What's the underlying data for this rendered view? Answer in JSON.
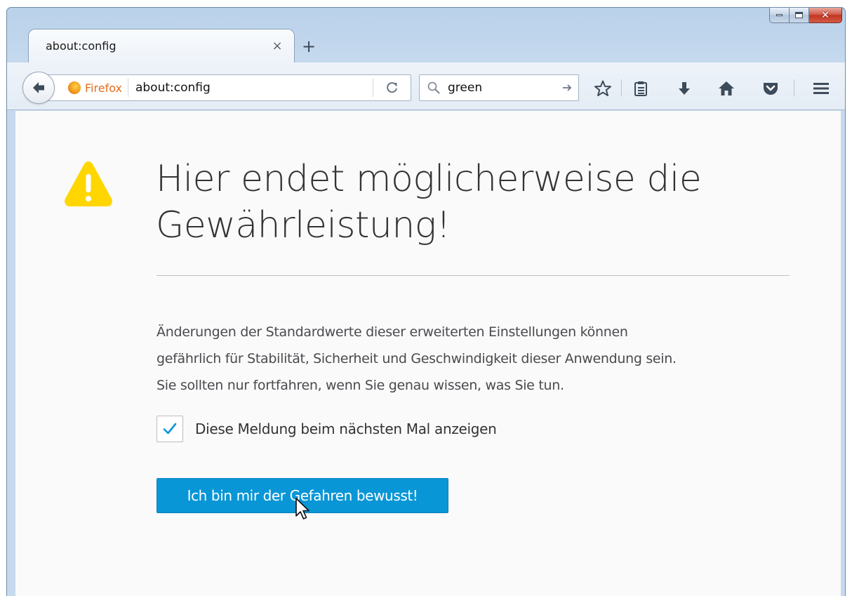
{
  "window": {
    "caption_buttons": {
      "minimize": "minimize",
      "maximize": "maximize",
      "close": "✕"
    }
  },
  "tabs": [
    {
      "title": "about:config",
      "close": "×"
    }
  ],
  "new_tab_label": "+",
  "navbar": {
    "identity_label": "Firefox",
    "url": "about:config",
    "search_value": "green"
  },
  "icons": {
    "back": "back-arrow-icon",
    "reload": "reload-icon",
    "search": "magnifier-icon",
    "search_go": "arrow-right-icon",
    "bookmark": "star-icon",
    "bookmarks_menu": "clipboard-list-icon",
    "downloads": "download-arrow-icon",
    "home": "home-icon",
    "pocket": "pocket-icon",
    "menu": "hamburger-icon",
    "warning": "warning-triangle-icon"
  },
  "page": {
    "title": "Hier endet möglicherweise die Gewährleistung!",
    "message_lines": [
      "Änderungen der Standardwerte dieser erweiterten Einstellungen können",
      "gefährlich für Stabilität, Sicherheit und Geschwindigkeit dieser Anwendung sein.",
      "Sie sollten nur fortfahren, wenn Sie genau wissen, was Sie tun."
    ],
    "checkbox_label": "Diese Meldung beim nächsten Mal anzeigen",
    "checkbox_checked": true,
    "accept_button": "Ich bin mir der Gefahren bewusst!"
  },
  "colors": {
    "accent_button": "#0996d6",
    "warning_yellow": "#ffd600",
    "checkmark": "#0996d6",
    "firefox_label": "#e56d1e"
  }
}
